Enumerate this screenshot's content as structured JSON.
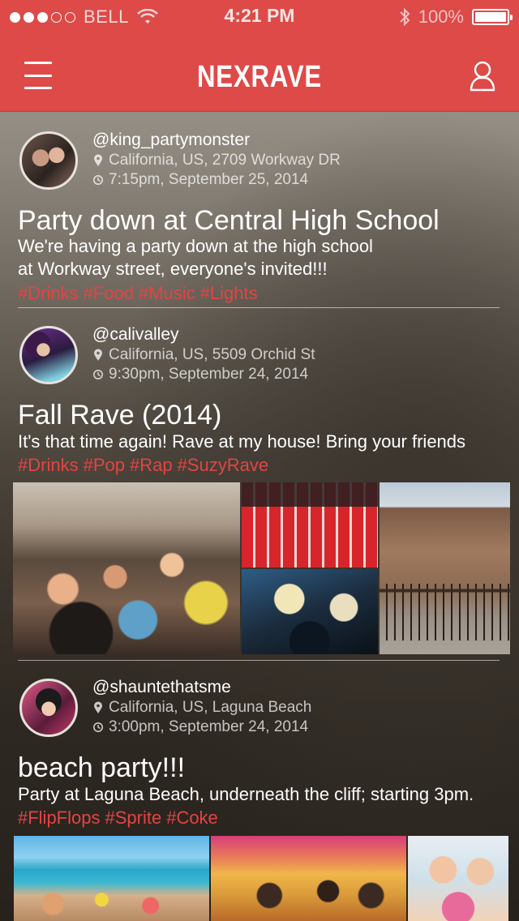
{
  "status_bar": {
    "carrier": "BELL",
    "time": "4:21 PM",
    "battery": "100%"
  },
  "navbar": {
    "title": "NEXRAVE"
  },
  "icons": {
    "menu": "hamburger-icon",
    "profile": "user-icon",
    "location": "location-pin-icon",
    "time": "clock-icon",
    "wifi": "wifi-icon",
    "bluetooth": "bluetooth-icon"
  },
  "colors": {
    "accent": "#dd4a48",
    "tag": "#e24543"
  },
  "posts": [
    {
      "username": "@king_partymonster",
      "location": "California, US, 2709 Workway DR",
      "time": "7:15pm, September 25, 2014",
      "title": "Party down at Central High School",
      "description_lines": [
        "We're having a party down at the high school",
        "at Workway street, everyone's invited!!!"
      ],
      "tags": [
        "#Drinks",
        "#Food",
        "#Music",
        "#Lights"
      ]
    },
    {
      "username": "@calivalley",
      "location": "California, US, 5509 Orchid St",
      "time": "9:30pm, September 24, 2014",
      "title": "Fall Rave (2014)",
      "description_lines": [
        "It's that time again! Rave at my house! Bring your friends"
      ],
      "tags": [
        "#Drinks",
        "#Pop",
        "#Rap",
        "#SuzyRave"
      ]
    },
    {
      "username": "@shauntethatsme",
      "location": "California, US, Laguna Beach",
      "time": "3:00pm, September 24, 2014",
      "title": "beach party!!!",
      "description_lines": [
        "Party at Laguna Beach, underneath the cliff; starting 3pm."
      ],
      "tags": [
        "#FlipFlops",
        "#Sprite",
        "#Coke"
      ]
    }
  ]
}
